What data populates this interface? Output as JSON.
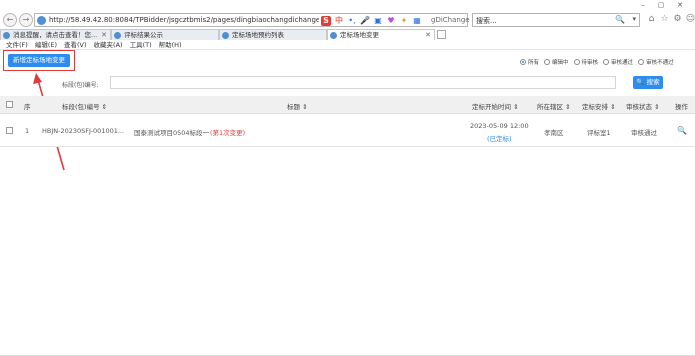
{
  "browser": {
    "window_controls": [
      "–",
      "▢",
      "✕"
    ],
    "nav_back": "←",
    "nav_forward": "→",
    "address": "http://58.49.42.80:8084/TPBidder/jsgcztbmis2/pages/dingbiaochangdichange/DingBia",
    "address_tail": "gDiChange ⊕ ↻",
    "address_icons": [
      "S",
      "中",
      "•,",
      "🎤",
      "▣",
      "♥",
      "✦",
      "▦"
    ],
    "search_placeholder": "搜索...",
    "search_icon": "🔍",
    "search_dropdown": "▾",
    "toolbar_icons": [
      "⌂",
      "☆",
      "⚙",
      "☺"
    ]
  },
  "tabs": [
    {
      "label": "消息提醒，请点击查看！您...",
      "close": "✕"
    },
    {
      "label": "评标结果公示",
      "close": ""
    },
    {
      "label": "定标场地预约列表",
      "close": ""
    },
    {
      "label": "定标场地变更",
      "close": "✕"
    }
  ],
  "menu": [
    "文件(F)",
    "编辑(E)",
    "查看(V)",
    "收藏夹(A)",
    "工具(T)",
    "帮助(H)"
  ],
  "page": {
    "add_button": "新增定标场地变更",
    "radios": [
      {
        "label": "所有",
        "checked": true
      },
      {
        "label": "编辑中",
        "checked": false
      },
      {
        "label": "待审核",
        "checked": false
      },
      {
        "label": "审核通过",
        "checked": false
      },
      {
        "label": "审核不通过",
        "checked": false
      }
    ],
    "filter_label": "标段(包)编号:",
    "filter_value": "",
    "search_button": "🔍 搜索"
  },
  "table": {
    "headers": {
      "seq": "序",
      "code": "标段(包)编号 ⇕",
      "title": "标题 ⇕",
      "start_time": "定标开始时间 ⇕",
      "district": "所在辖区 ⇕",
      "arrange": "定标安排 ⇕",
      "status": "审核状态 ⇕",
      "action": "操作"
    },
    "rows": [
      {
        "seq": "1",
        "code": "HBJN-20230SFJ-001001...",
        "title": "国泰测试项目0504标段一",
        "title_note": "(第1次变更)",
        "start_time": "2023-05-09 12:00",
        "start_note": "(已定标)",
        "district": "孝南区",
        "arrange": "评标室1",
        "status": "审核通过",
        "action_icon": "🔍"
      }
    ]
  },
  "colors": {
    "accent": "#2d8cf0",
    "highlight": "#e03a3a"
  }
}
